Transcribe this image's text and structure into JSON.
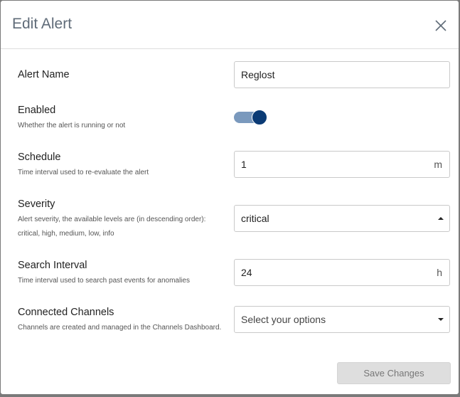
{
  "dialog": {
    "title": "Edit Alert",
    "close_icon": "close-icon"
  },
  "fields": {
    "alert_name": {
      "label": "Alert Name",
      "value": "Reglost"
    },
    "enabled": {
      "label": "Enabled",
      "help": "Whether the alert is running or not",
      "on": true
    },
    "schedule": {
      "label": "Schedule",
      "help": "Time interval used to re-evaluate the alert",
      "value": "1",
      "unit": "m"
    },
    "severity": {
      "label": "Severity",
      "help_line1": "Alert severity, the available levels are (in descending order):",
      "help_line2": "critical, high, medium, low, info",
      "value": "critical"
    },
    "search_interval": {
      "label": "Search Interval",
      "help": "Time interval used to search past events for anomalies",
      "value": "24",
      "unit": "h"
    },
    "connected_channels": {
      "label": "Connected Channels",
      "help": "Channels are created and managed in the Channels Dashboard.",
      "placeholder": "Select your options"
    }
  },
  "footer": {
    "save_label": "Save Changes"
  },
  "colors": {
    "toggle_track": "#7a99bd",
    "toggle_knob": "#0b3b75",
    "disabled_button": "#dedede"
  }
}
